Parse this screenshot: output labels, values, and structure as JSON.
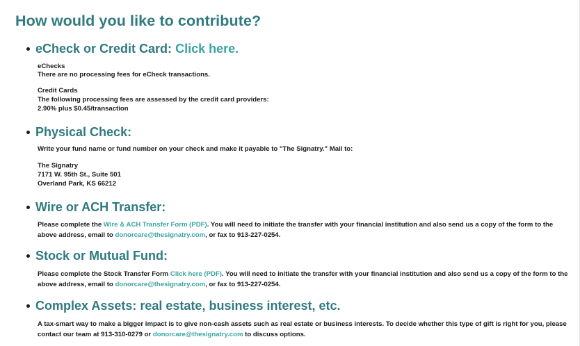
{
  "title": "How would you like to contribute?",
  "sections": {
    "echeck": {
      "heading": "eCheck or Credit Card:",
      "link": "Click here.",
      "echecks_label": "eChecks",
      "echecks_text": "There are no processing fees for eCheck transactions.",
      "cc_label": "Credit Cards",
      "cc_text": "The following processing fees are assessed by the credit card providers:",
      "cc_fee": "2.90% plus $0.45/transaction"
    },
    "physical": {
      "heading": "Physical Check:",
      "instructions": "Write your fund name or fund number on your check and make it payable to \"The Signatry.\" Mail to:",
      "address_name": "The Signatry",
      "address_line1": "7171 W. 95th St., Suite 501",
      "address_line2": "Overland Park, KS 66212"
    },
    "wire": {
      "heading": "Wire or ACH Transfer:",
      "text1": "Please complete the ",
      "link": "Wire & ACH Transfer Form (PDF)",
      "text2": ". You will need to initiate the transfer with your financial institution and also send us a copy of the form to the above address, email to ",
      "email": "donorcare@thesignatry.com",
      "text3": ", or fax to 913-227-0254."
    },
    "stock": {
      "heading": "Stock or Mutual Fund:",
      "text1": "Please complete the Stock Transfer Form ",
      "link": "Click here (PDF)",
      "text2": ". You will need to initiate the transfer with your financial institution and also send us a copy of the form to the above address, email to ",
      "email": "donorcare@thesignatry.com",
      "text3": ", or fax to 913-227-0254."
    },
    "complex": {
      "heading": "Complex Assets: real estate, business interest, etc.",
      "text1": "A tax-smart way to make a bigger impact is to give non-cash assets such as real estate or business interests. To decide whether this type of gift is right for you, please contact our team at 913-310-0279 or ",
      "email": "donorcare@thesignatry.com",
      "text2": " to discuss options."
    }
  }
}
